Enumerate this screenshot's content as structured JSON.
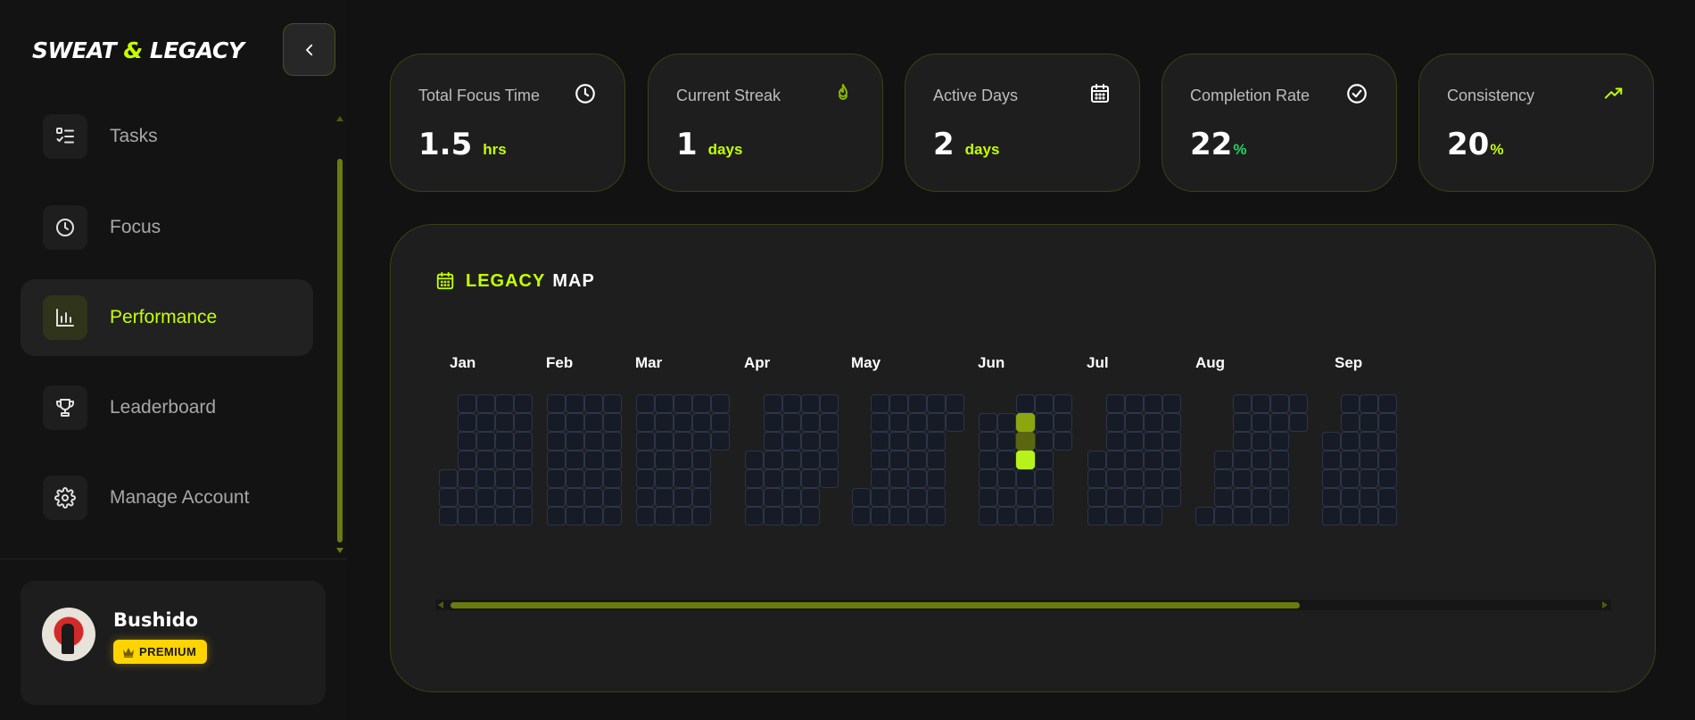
{
  "app": {
    "logo_left": "SWEAT ",
    "logo_amp": "&",
    "logo_right": " LEGACY"
  },
  "sidebar": {
    "collapse_icon": "chevron-left-icon",
    "items": [
      {
        "label": "Tasks",
        "icon": "checklist-icon",
        "active": false
      },
      {
        "label": "Focus",
        "icon": "clock-icon",
        "active": false
      },
      {
        "label": "Performance",
        "icon": "bar-chart-icon",
        "active": true
      },
      {
        "label": "Leaderboard",
        "icon": "trophy-icon",
        "active": false
      },
      {
        "label": "Manage Account",
        "icon": "gear-icon",
        "active": false
      }
    ]
  },
  "user": {
    "name": "Bushido",
    "badge": "PREMIUM",
    "badge_icon": "crown-icon"
  },
  "stats": [
    {
      "label": "Total Focus Time",
      "value": "1.5",
      "unit": "hrs",
      "icon": "clock-icon"
    },
    {
      "label": "Current Streak",
      "value": "1",
      "unit": "days",
      "icon": "flame-icon"
    },
    {
      "label": "Active Days",
      "value": "2",
      "unit": "days",
      "icon": "calendar-icon"
    },
    {
      "label": "Completion Rate",
      "value": "22",
      "unit": "%",
      "icon": "check-circle-icon"
    },
    {
      "label": "Consistency",
      "value": "20",
      "unit": "%",
      "icon": "trending-up-icon"
    }
  ],
  "legacy_map": {
    "title_accent": "LEGACY",
    "title_plain": "MAP",
    "months": [
      "Jan",
      "Feb",
      "Mar",
      "Apr",
      "May",
      "Jun",
      "Jul",
      "Aug",
      "Sep"
    ]
  },
  "colors": {
    "accent": "#c6ff00",
    "premium": "#ffd400",
    "percent_green": "#1ed760",
    "cell_empty": "#161b25",
    "cell_active_low": "#5b6611",
    "cell_active_mid": "#8ca60f",
    "cell_active_high": "#b8f21b"
  }
}
